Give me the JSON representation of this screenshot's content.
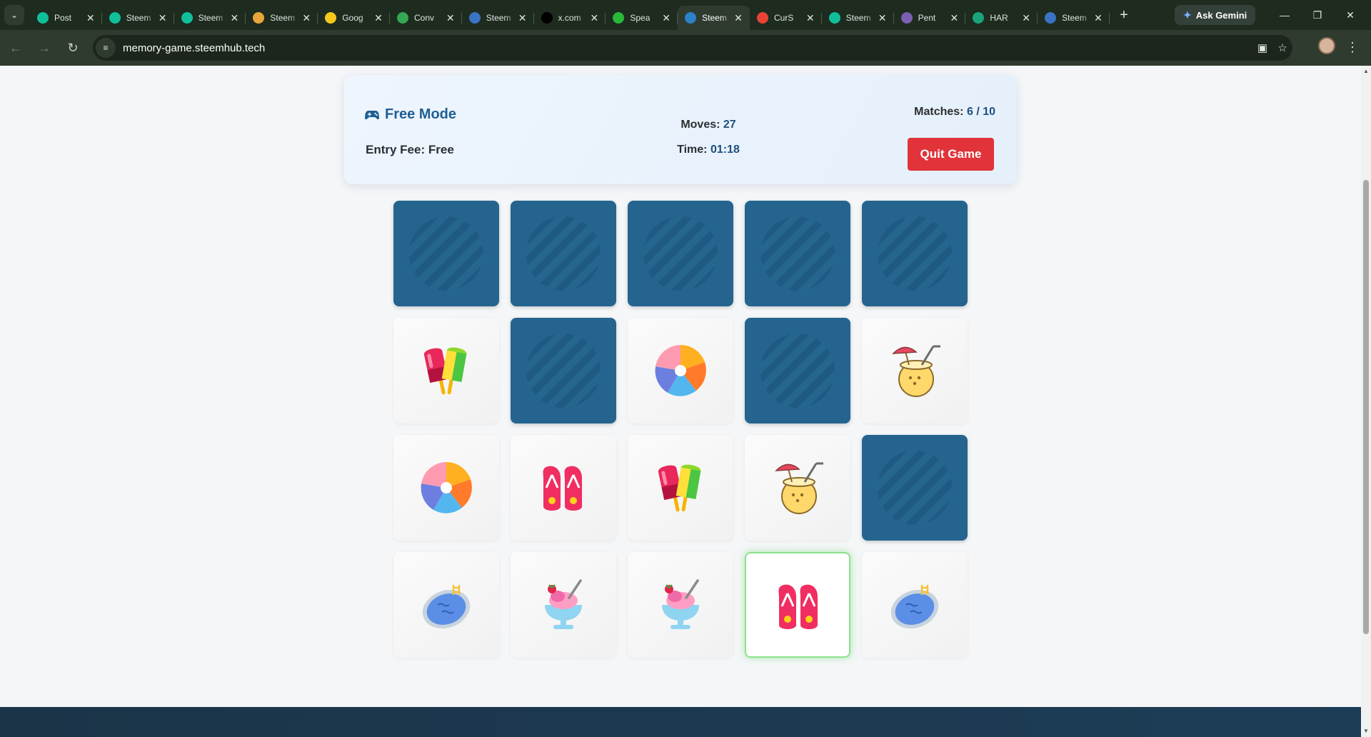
{
  "browser": {
    "tabs": [
      {
        "title": "Post",
        "favicon": "steem-icon",
        "color": "#0fbf9a",
        "active": false
      },
      {
        "title": "Steem",
        "favicon": "steem-icon",
        "color": "#0fbf9a",
        "active": false
      },
      {
        "title": "Steem",
        "favicon": "steem-icon",
        "color": "#0fbf9a",
        "active": false
      },
      {
        "title": "Steem",
        "favicon": "steem-emoji-icon",
        "color": "#e8a53a",
        "active": false
      },
      {
        "title": "Goog",
        "favicon": "bulb-icon",
        "color": "#f7c81b",
        "active": false
      },
      {
        "title": "Conv",
        "favicon": "drive-icon",
        "color": "#34a853",
        "active": false
      },
      {
        "title": "Steem",
        "favicon": "globe-icon",
        "color": "#3b73c4",
        "active": false
      },
      {
        "title": "x.com",
        "favicon": "x-icon",
        "color": "#000000",
        "active": false
      },
      {
        "title": "Spea",
        "favicon": "play-icon",
        "color": "#2ab83a",
        "active": false
      },
      {
        "title": "Steem",
        "favicon": "steem-icon",
        "color": "#2a83c9",
        "active": true
      },
      {
        "title": "CurS",
        "favicon": "google-icon",
        "color": "#ea4335",
        "active": false
      },
      {
        "title": "Steem",
        "favicon": "steem-icon",
        "color": "#0fbf9a",
        "active": false
      },
      {
        "title": "Pent",
        "favicon": "pent-icon",
        "color": "#7b5fb0",
        "active": false
      },
      {
        "title": "HAR",
        "favicon": "ba-icon",
        "color": "#1aa37a",
        "active": false
      },
      {
        "title": "Steem",
        "favicon": "globe-icon",
        "color": "#3b73c4",
        "active": false
      }
    ],
    "gemini_label": "Ask Gemini",
    "url": "memory-game.steemhub.tech"
  },
  "game": {
    "mode_title": "Free Mode",
    "entry_fee_label": "Entry Fee:",
    "entry_fee_value": "Free",
    "moves_label": "Moves:",
    "moves_value": "27",
    "time_label": "Time:",
    "time_value": "01:18",
    "matches_label": "Matches:",
    "matches_value": "6 / 10",
    "quit_label": "Quit Game"
  },
  "board": {
    "columns": 5,
    "rows": 4,
    "cards": [
      {
        "state": "hidden",
        "icon": ""
      },
      {
        "state": "hidden",
        "icon": ""
      },
      {
        "state": "hidden",
        "icon": ""
      },
      {
        "state": "hidden",
        "icon": ""
      },
      {
        "state": "hidden",
        "icon": ""
      },
      {
        "state": "matched",
        "icon": "popsicle-icon"
      },
      {
        "state": "hidden",
        "icon": ""
      },
      {
        "state": "matched",
        "icon": "beach-ball-icon"
      },
      {
        "state": "hidden",
        "icon": ""
      },
      {
        "state": "matched",
        "icon": "coconut-drink-icon"
      },
      {
        "state": "matched",
        "icon": "beach-ball-icon"
      },
      {
        "state": "matched",
        "icon": "flip-flops-icon"
      },
      {
        "state": "matched",
        "icon": "popsicle-icon"
      },
      {
        "state": "matched",
        "icon": "coconut-drink-icon"
      },
      {
        "state": "hidden",
        "icon": ""
      },
      {
        "state": "matched",
        "icon": "pool-icon"
      },
      {
        "state": "matched",
        "icon": "ice-cream-sundae-icon"
      },
      {
        "state": "matched",
        "icon": "ice-cream-sundae-icon"
      },
      {
        "state": "selected",
        "icon": "flip-flops-icon"
      },
      {
        "state": "matched",
        "icon": "pool-icon"
      }
    ]
  },
  "colors": {
    "card_back": "#24648f",
    "accent_blue": "#1e5f95",
    "quit_red": "#e13339",
    "selected_glow": "#8fe08f"
  }
}
